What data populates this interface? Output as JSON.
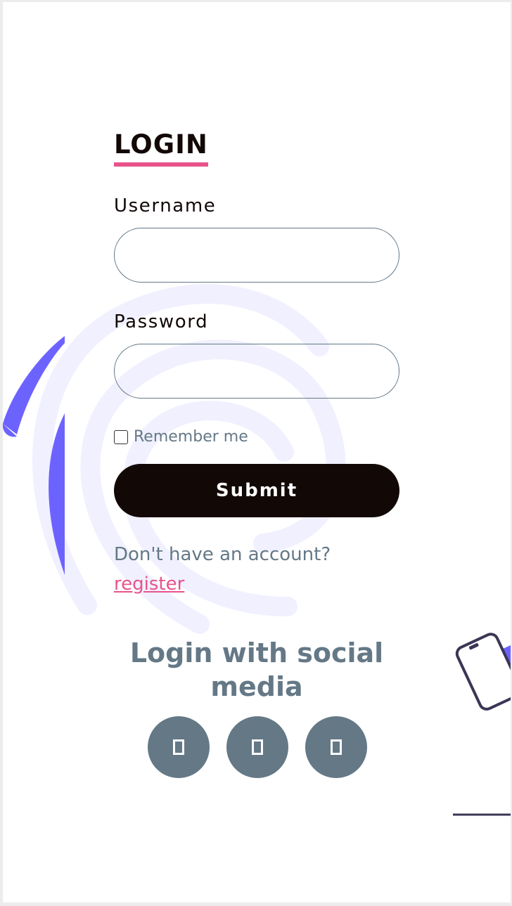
{
  "login": {
    "title": "LOGIN",
    "username_label": "Username",
    "username_value": "",
    "password_label": "Password",
    "password_value": "",
    "remember_label": "Remember me",
    "remember_checked": false,
    "submit_label": "Submit",
    "no_account_text": "Don't have an account?",
    "register_label": "register"
  },
  "social": {
    "title": "Login with social media",
    "buttons": [
      {
        "icon": "missing-glyph-icon"
      },
      {
        "icon": "missing-glyph-icon"
      },
      {
        "icon": "missing-glyph-icon"
      }
    ]
  },
  "colors": {
    "accent_pink": "#e8538b",
    "primary_dark": "#120806",
    "slate": "#647886",
    "purple": "#6c63ff",
    "lavender": "#f0f0ff"
  }
}
